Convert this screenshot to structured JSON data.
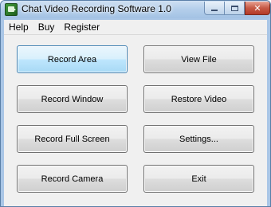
{
  "window": {
    "title": "Chat Video Recording Software 1.0",
    "icon": "app-icon",
    "controls": {
      "minimize": "minimize-icon",
      "maximize": "maximize-icon",
      "close": "✕"
    }
  },
  "menu": {
    "items": [
      "Help",
      "Buy",
      "Register"
    ]
  },
  "buttons": {
    "record_area": "Record Area",
    "view_file": "View File",
    "record_window": "Record Window",
    "restore_video": "Restore Video",
    "record_full_screen": "Record Full Screen",
    "settings": "Settings...",
    "record_camera": "Record Camera",
    "exit": "Exit"
  },
  "colors": {
    "title_bar": "#b5cfeb",
    "focused_button_border": "#3c7fb1",
    "close_button": "#c75a46"
  }
}
